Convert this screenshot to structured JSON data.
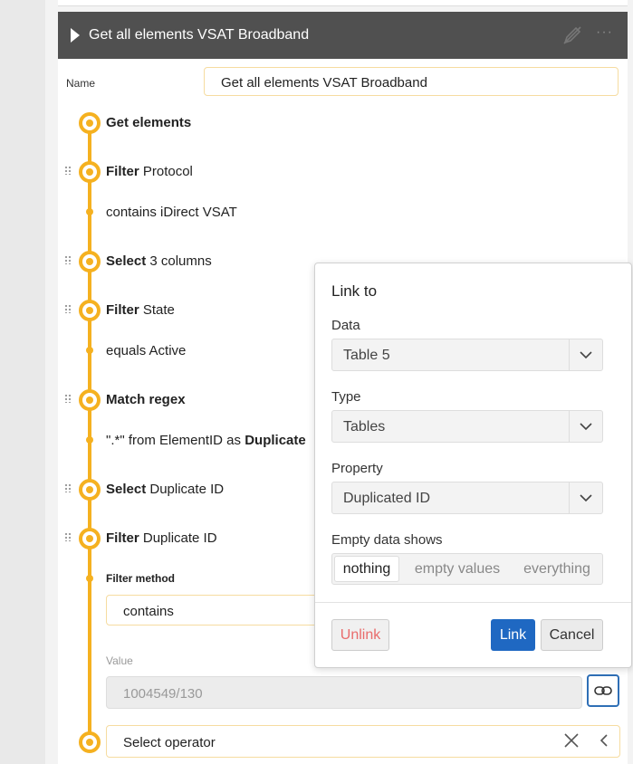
{
  "header": {
    "title": "Get all elements VSAT Broadband"
  },
  "name_field": {
    "label": "Name",
    "value": "Get all elements VSAT Broadband"
  },
  "steps": [
    {
      "bold": "Get elements",
      "rest": ""
    },
    {
      "bold": "Filter",
      "rest": " Protocol",
      "detail": "contains iDirect VSAT"
    },
    {
      "bold": "Select",
      "rest": " 3 columns"
    },
    {
      "bold": "Filter",
      "rest": " State",
      "detail": "equals Active"
    },
    {
      "bold": "Match regex",
      "rest": "",
      "detail_pre": "\".*\" from ElementID as ",
      "detail_bold": "Duplicate"
    },
    {
      "bold": "Select",
      "rest": " Duplicate ID"
    },
    {
      "bold": "Filter",
      "rest": " Duplicate ID"
    }
  ],
  "filter_method": {
    "label": "Filter method",
    "value": "contains"
  },
  "value_field": {
    "label": "Value",
    "value": "1004549/130"
  },
  "operator": {
    "placeholder": "Select operator"
  },
  "popup": {
    "title": "Link to",
    "data": {
      "label": "Data",
      "value": "Table 5"
    },
    "type": {
      "label": "Type",
      "value": "Tables"
    },
    "property": {
      "label": "Property",
      "value": "Duplicated ID"
    },
    "empty": {
      "label": "Empty data shows",
      "options": [
        "nothing",
        "empty values",
        "everything"
      ],
      "selected": "nothing"
    },
    "unlink_label": "Unlink",
    "link_label": "Link",
    "cancel_label": "Cancel"
  },
  "colors": {
    "accent": "#f5b120",
    "header_bg": "#505050",
    "primary_button": "#1f68c2",
    "danger_text": "#e96b6b"
  }
}
